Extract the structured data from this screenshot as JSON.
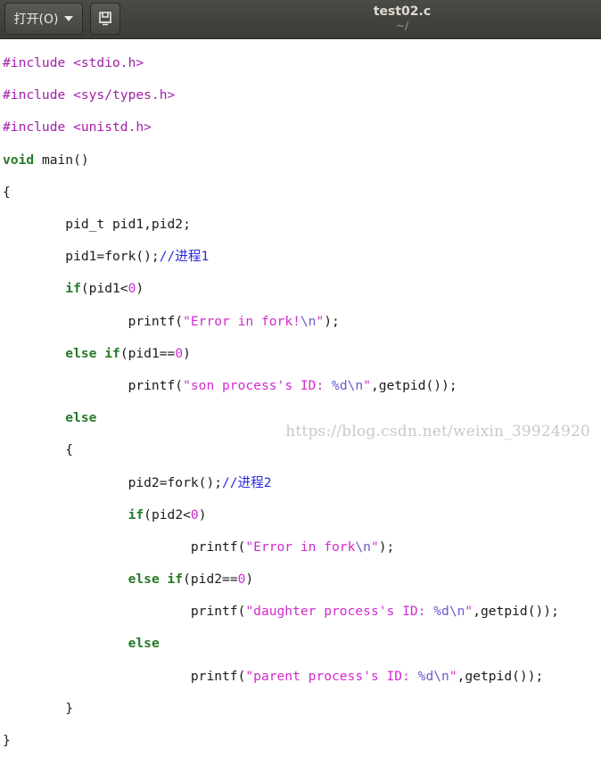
{
  "toolbar": {
    "open_label": "打开(O)",
    "open_icon": "chevron-down-icon",
    "save_icon": "save-document-icon"
  },
  "window": {
    "title": "test02.c",
    "subtitle": "~/"
  },
  "code": {
    "l1": {
      "pp": "#include <stdio.h>"
    },
    "l2": {
      "pp": "#include <sys/types.h>"
    },
    "l3": {
      "pp": "#include <unistd.h>"
    },
    "l4": {
      "kw": "void",
      "rest": " main()"
    },
    "l5": {
      "text": "{"
    },
    "l6": {
      "text": "        pid_t pid1,pid2;"
    },
    "l7": {
      "text": "        pid1=fork();",
      "cmt": "//进程1"
    },
    "l8": {
      "indent": "        ",
      "kw": "if",
      "a": "(pid1<",
      "num": "0",
      "b": ")"
    },
    "l9": {
      "indent": "                printf(",
      "str": "\"Error in fork!",
      "esc": "\\n",
      "str2": "\"",
      "b": ");"
    },
    "l10": {
      "indent": "        ",
      "kw": "else if",
      "a": "(pid1==",
      "num": "0",
      "b": ")"
    },
    "l11": {
      "indent": "                printf(",
      "str": "\"son process's ID: ",
      "esc": "%d\\n",
      "str2": "\"",
      "b": ",getpid());"
    },
    "l12": {
      "indent": "        ",
      "kw": "else"
    },
    "l13": {
      "text": "        {"
    },
    "l14": {
      "text": "                pid2=fork();",
      "cmt": "//进程2"
    },
    "l15": {
      "indent": "                ",
      "kw": "if",
      "a": "(pid2<",
      "num": "0",
      "b": ")"
    },
    "l16": {
      "indent": "                        printf(",
      "str": "\"Error in fork",
      "esc": "\\n",
      "str2": "\"",
      "b": ");"
    },
    "l17": {
      "indent": "                ",
      "kw": "else if",
      "a": "(pid2==",
      "num": "0",
      "b": ")"
    },
    "l18": {
      "indent": "                        printf(",
      "str": "\"daughter process's ID: ",
      "esc": "%d\\n",
      "str2": "\"",
      "b": ",getpid());"
    },
    "l19": {
      "indent": "                ",
      "kw": "else"
    },
    "l20": {
      "indent": "                        printf(",
      "str": "\"parent process's ID: ",
      "esc": "%d\\n",
      "str2": "\"",
      "b": ",getpid());"
    },
    "l21": {
      "text": "        }"
    },
    "l22": {
      "text": "}"
    }
  },
  "watermark": "https://blog.csdn.net/weixin_39924920"
}
